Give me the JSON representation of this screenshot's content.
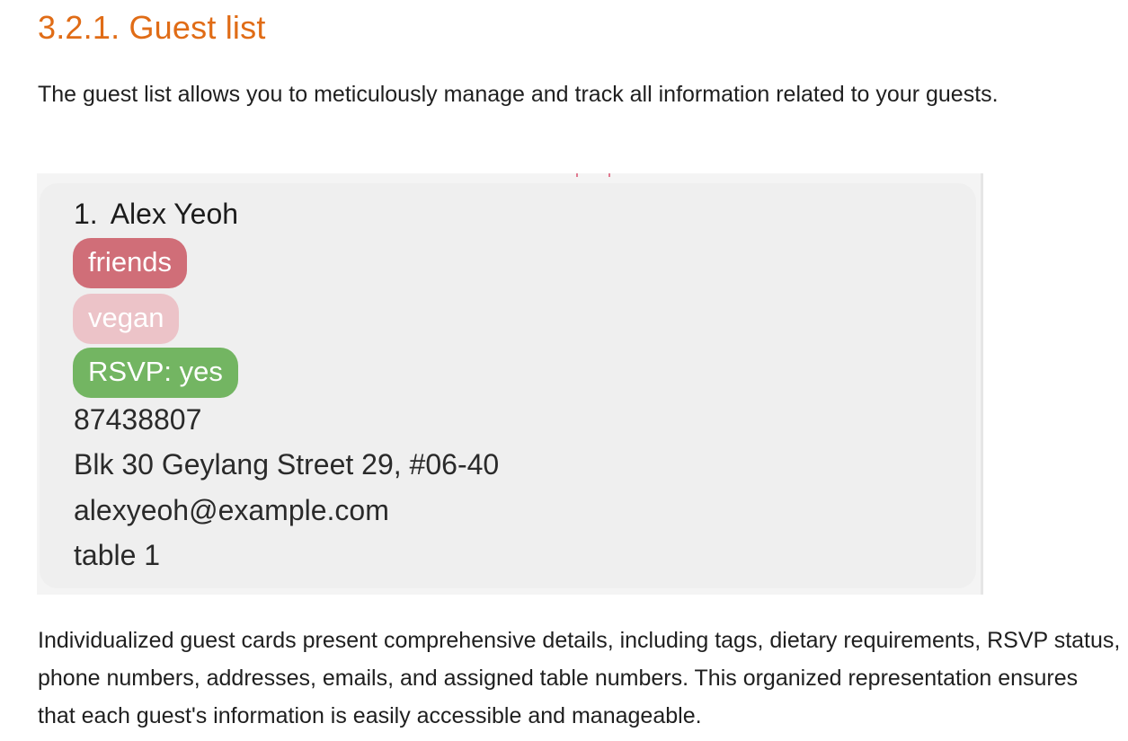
{
  "section": {
    "heading": "3.2.1. Guest list",
    "intro": "The guest list allows you to meticulously manage and track all information related to your guests.",
    "description": "Individualized guest cards present comprehensive details, including tags, dietary requirements, RSVP status, phone numbers, addresses, emails, and assigned table numbers. This organized representation ensures that each guest's information is easily accessible and manageable."
  },
  "guest_card": {
    "index": "1.",
    "name": "Alex Yeoh",
    "tags": [
      {
        "label": "friends",
        "color": "#d06e78"
      },
      {
        "label": "vegan",
        "color": "#ecc3c8"
      },
      {
        "label": "RSVP: yes",
        "color": "#73b562"
      }
    ],
    "phone": "87438807",
    "address": "Blk 30 Geylang Street 29, #06-40",
    "email": "alexyeoh@example.com",
    "table": "table 1"
  },
  "colors": {
    "heading": "#e06c16",
    "card_background": "#efefef",
    "text": "#1f1f1f"
  }
}
